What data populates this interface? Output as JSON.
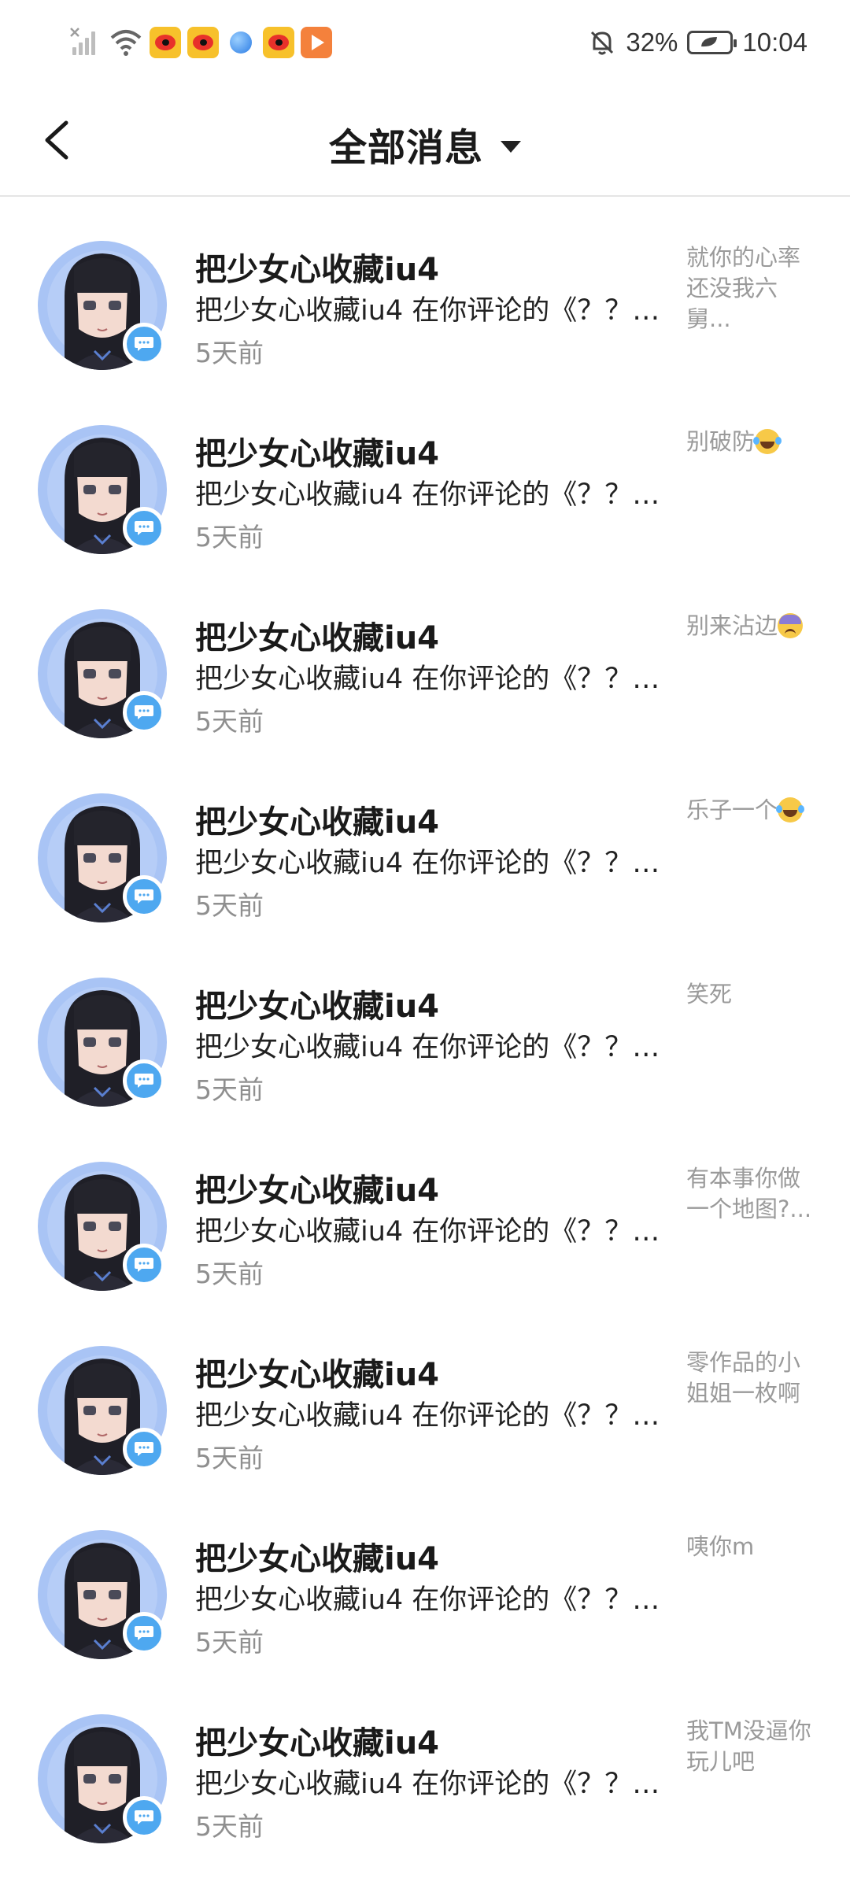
{
  "status_bar": {
    "battery_percent": "32%",
    "time": "10:04",
    "icons": [
      "signal-icon",
      "wifi-icon",
      "weibo-icon",
      "weibo-icon",
      "browser-icon",
      "weibo-icon",
      "video-icon",
      "mute-bell-icon",
      "battery-icon"
    ]
  },
  "header": {
    "back_icon": "back-arrow-icon",
    "title": "全部消息",
    "dropdown_icon": "caret-down-icon"
  },
  "messages": [
    {
      "name": "把少女心收藏iu4",
      "desc": "把少女心收藏iu4 在你评论的《？？…",
      "time": "5天前",
      "reply": "就你的心率还没我六舅...",
      "emoji": ""
    },
    {
      "name": "把少女心收藏iu4",
      "desc": "把少女心收藏iu4 在你评论的《？？…",
      "time": "5天前",
      "reply": "别破防",
      "emoji": "laugh"
    },
    {
      "name": "把少女心收藏iu4",
      "desc": "把少女心收藏iu4 在你评论的《？？…",
      "time": "5天前",
      "reply": "别来沾边",
      "emoji": "sad"
    },
    {
      "name": "把少女心收藏iu4",
      "desc": "把少女心收藏iu4 在你评论的《？？…",
      "time": "5天前",
      "reply": "乐子一个",
      "emoji": "laugh"
    },
    {
      "name": "把少女心收藏iu4",
      "desc": "把少女心收藏iu4 在你评论的《？？…",
      "time": "5天前",
      "reply": "笑死",
      "emoji": ""
    },
    {
      "name": "把少女心收藏iu4",
      "desc": "把少女心收藏iu4 在你评论的《？？…",
      "time": "5天前",
      "reply": "有本事你做一个地图?...",
      "emoji": ""
    },
    {
      "name": "把少女心收藏iu4",
      "desc": "把少女心收藏iu4 在你评论的《？？…",
      "time": "5天前",
      "reply": "零作品的小姐姐一枚啊",
      "emoji": ""
    },
    {
      "name": "把少女心收藏iu4",
      "desc": "把少女心收藏iu4 在你评论的《？？…",
      "time": "5天前",
      "reply": "咦你m",
      "emoji": ""
    },
    {
      "name": "把少女心收藏iu4",
      "desc": "把少女心收藏iu4 在你评论的《？？…",
      "time": "5天前",
      "reply": "我TM没逼你玩儿吧",
      "emoji": ""
    }
  ],
  "colors": {
    "badge": "#4ea8f0",
    "avatar_bg": "#a9c4f5",
    "reply_text": "#9a9a9a",
    "time_text": "#8f8f8f"
  }
}
